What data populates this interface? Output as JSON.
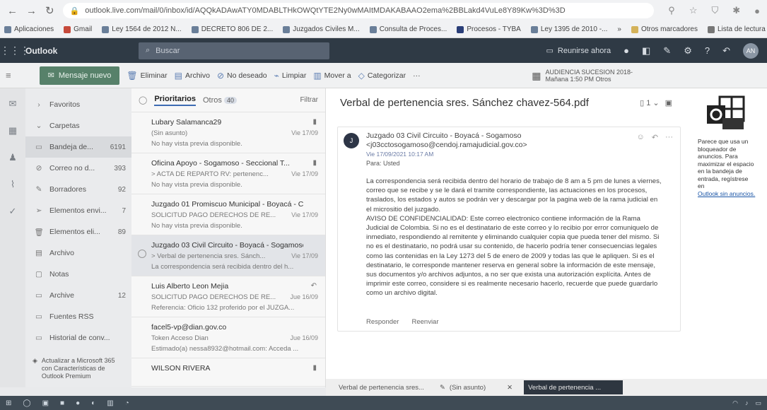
{
  "browser": {
    "url": "outlook.live.com/mail/0/inbox/id/AQQkADAwATY0MDABLTHkOWQtYTE2Ny0wMAItMDAKABAAO2ema%2BBLakd4VuLe8Y89Kw%3D%3D",
    "bookmarks": [
      "Aplicaciones",
      "Gmail",
      "Ley 1564 de 2012 N...",
      "DECRETO 806 DE 2...",
      "Juzgados Civiles M...",
      "Consulta de Proces...",
      "Procesos - TYBA",
      "Ley 1395 de 2010 -...",
      "»",
      "Otros marcadores",
      "Lista de lectura"
    ]
  },
  "header": {
    "brand": "Outlook",
    "search_placeholder": "Buscar",
    "meet_now": "Reunirse ahora",
    "avatar": "AN"
  },
  "ribbon": {
    "new_mail": "Mensaje nuevo",
    "delete": "Eliminar",
    "archive": "Archivo",
    "junk": "No deseado",
    "sweep": "Limpiar",
    "move": "Mover a",
    "categorize": "Categorizar",
    "more": "···",
    "reminder_title": "AUDIENCIA SUCESION 2018-",
    "reminder_time": "Mañana 1:50 PM Otros"
  },
  "folders": [
    {
      "label": "Favoritos",
      "count": ""
    },
    {
      "label": "Carpetas",
      "count": ""
    },
    {
      "label": "Bandeja de...",
      "count": "6191"
    },
    {
      "label": "Correo no d...",
      "count": "393"
    },
    {
      "label": "Borradores",
      "count": "92"
    },
    {
      "label": "Elementos envi...",
      "count": "7"
    },
    {
      "label": "Elementos eli...",
      "count": "89"
    },
    {
      "label": "Archivo",
      "count": ""
    },
    {
      "label": "Notas",
      "count": ""
    },
    {
      "label": "Archive",
      "count": "12"
    },
    {
      "label": "Fuentes RSS",
      "count": ""
    },
    {
      "label": "Historial de conv...",
      "count": ""
    }
  ],
  "upgrade_text": "Actualizar a Microsoft 365 con Características de Outlook Premium",
  "list": {
    "tab_focused": "Prioritarios",
    "tab_other": "Otros",
    "other_count": "40",
    "filter": "Filtrar",
    "messages": [
      {
        "sender": "Lubary Salamanca29",
        "subject": "(Sin asunto)",
        "date": "Vie 17/09",
        "preview": "No hay vista previa disponible."
      },
      {
        "sender": "Oficina Apoyo - Sogamoso - Seccional T...",
        "subject": "> ACTA DE REPARTO RV: pertenenc...",
        "date": "Vie 17/09",
        "preview": "No hay vista previa disponible."
      },
      {
        "sender": "Juzgado 01 Promiscuo Municipal - Boyacá - C...",
        "subject": "SOLICITUD PAGO DERECHOS DE RE...",
        "date": "Vie 17/09",
        "preview": "No hay vista previa disponible."
      },
      {
        "sender": "Juzgado 03 Civil Circuito - Boyacá - Sogamoso",
        "subject": "> Verbal de pertenencia sres. Sánch...",
        "date": "Vie 17/09",
        "preview": "La correspondencia será recibida dentro del h..."
      },
      {
        "sender": "Luis Alberto Leon Mejia",
        "subject": "SOLICITUD PAGO DERECHOS DE RE...",
        "date": "Jue 16/09",
        "preview": "Referencia: Oficio 132 proferido por el JUZGA..."
      },
      {
        "sender": "facel5-vp@dian.gov.co",
        "subject": "Token Acceso Dian",
        "date": "Jue 16/09",
        "preview": "Estimado(a) nessa8932@hotmail.com: Acceda ..."
      },
      {
        "sender": "WILSON RIVERA",
        "subject": "",
        "date": "",
        "preview": ""
      }
    ]
  },
  "reading": {
    "title": "Verbal de pertenencia sres. Sánchez chavez-564.pdf",
    "counter": "1",
    "sender": "Juzgado 03 Civil Circuito - Boyacá - Sogamoso",
    "email": "<j03cctosogamoso@cendoj.ramajudicial.gov.co>",
    "date": "Vie 17/09/2021 10:17 AM",
    "to": "Para: Usted",
    "body_p1": "La correspondencia será recibida dentro del horario de trabajo de 8 am a 5 pm de lunes a viernes, correo que se recibe y se le dará el tramite correspondiente, las actuaciones en los procesos, traslados, los estados y autos se podrán ver y descargar por la pagina web de la rama judicial en el micrositio del juzgado.",
    "body_p2": "AVISO DE CONFIDENCIALIDAD: Este correo electronico contiene información de la Rama Judicial de Colombia. Si no es el destinatario de este correo y lo recibio por error comuniquelo de inmediato, respondiendo al remitente y eliminando cualquier copia que pueda tener del mismo. Si no es el destinatario, no podrá usar su contenido, de hacerlo podría tener consecuencias legales como las contenidas en la Ley 1273 del 5 de enero de 2009 y todas las que le apliquen. Si es el destinatario, le corresponde mantener reserva en general sobre la información de este mensaje, sus documentos y/o archivos adjuntos, a no ser que exista una autorización explícita. Antes de imprimir este correo, considere si es realmente necesario hacerlo, recuerde que puede guardarlo como un archivo digital.",
    "reply": "Responder",
    "forward": "Reenviar"
  },
  "ad": {
    "text": "Parece que usa un bloqueador de anuncios. Para maximizar el espacio en la bandeja de entrada, regístrese en",
    "link": "Outlook sin anuncios."
  },
  "drafts": [
    {
      "label": "Verbal de pertenencia sres..."
    },
    {
      "label": "(Sin asunto)"
    },
    {
      "label": "Verbal de pertenencia ..."
    }
  ],
  "colors": {
    "header": "#2f3a45",
    "new_mail": "#57816a",
    "accent": "#3d6bb3"
  }
}
